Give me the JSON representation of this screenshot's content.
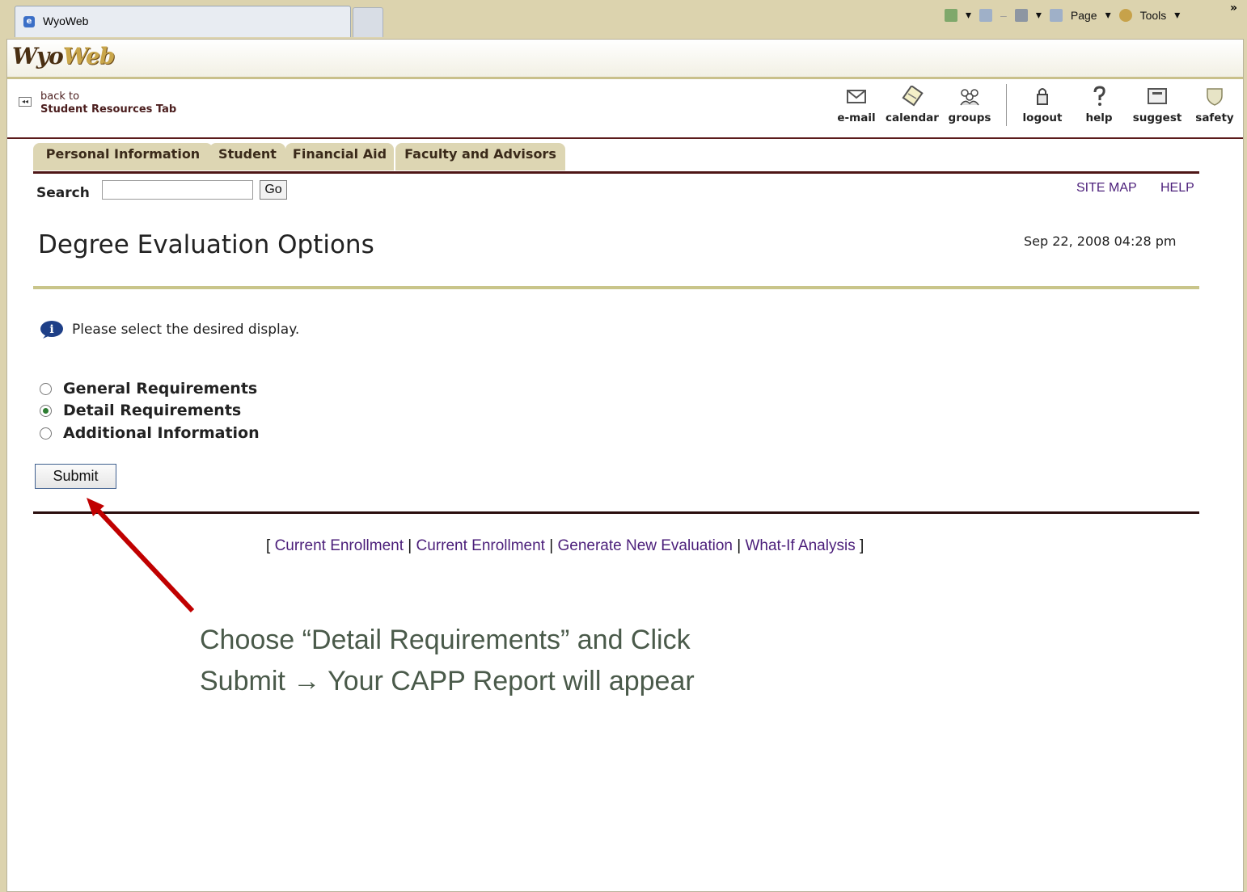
{
  "browser": {
    "tab_title": "WyoWeb",
    "page_menu": "Page",
    "tools_menu": "Tools"
  },
  "brand": {
    "logo_part1": "Wyo",
    "logo_part2": "Web"
  },
  "nav": {
    "back_line1": "back to",
    "back_line2": "Student Resources Tab",
    "tools": [
      {
        "label": "e-mail",
        "icon": "envelope"
      },
      {
        "label": "calendar",
        "icon": "calendar"
      },
      {
        "label": "groups",
        "icon": "people"
      },
      {
        "label": "logout",
        "icon": "padlock"
      },
      {
        "label": "help",
        "icon": "question"
      },
      {
        "label": "suggest",
        "icon": "suggestion-box"
      },
      {
        "label": "safety",
        "icon": "shield"
      }
    ]
  },
  "tabs": [
    "Personal Information",
    "Student",
    "Financial Aid",
    "Faculty and Advisors"
  ],
  "search": {
    "label": "Search",
    "go": "Go",
    "value": ""
  },
  "links": {
    "site_map": "SITE MAP",
    "help": "HELP"
  },
  "page": {
    "title": "Degree Evaluation Options",
    "datetime": "Sep 22, 2008 04:28 pm",
    "info": "Please select the desired display."
  },
  "options": {
    "items": [
      "General Requirements",
      "Detail Requirements",
      "Additional Information"
    ],
    "selected": "Detail Requirements"
  },
  "submit_label": "Submit",
  "footer": {
    "open": "[",
    "close": "]",
    "sep": "|",
    "links": [
      "Current Enrollment",
      "Current Enrollment",
      "Generate New Evaluation",
      "What-If Analysis"
    ]
  },
  "annotation": {
    "line1": "Choose “Detail Requirements” and Click",
    "line2": "Submit → Your CAPP Report will appear",
    "arrow_color": "#c00000"
  },
  "colors": {
    "maroon": "#4e1616",
    "gold": "#c9a64a",
    "link": "#4b1e7a"
  }
}
